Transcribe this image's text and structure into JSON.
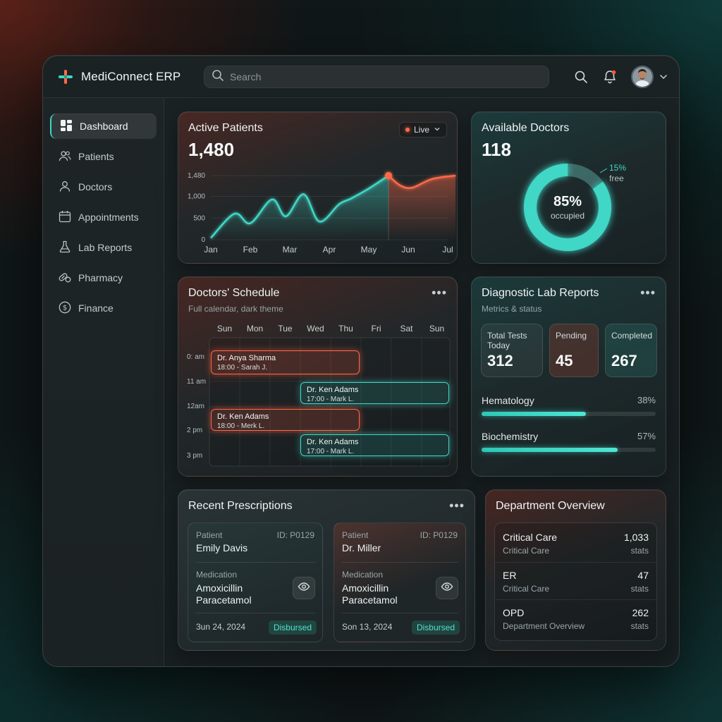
{
  "app": {
    "name": "MediConnect ERP"
  },
  "search": {
    "placeholder": "Search"
  },
  "sidebar": {
    "items": [
      {
        "label": "Dashboard",
        "icon": "grid-icon",
        "active": true
      },
      {
        "label": "Patients",
        "icon": "users-icon"
      },
      {
        "label": "Doctors",
        "icon": "user-icon"
      },
      {
        "label": "Appointments",
        "icon": "calendar-icon"
      },
      {
        "label": "Lab Reports",
        "icon": "flask-icon"
      },
      {
        "label": "Pharmacy",
        "icon": "pill-icon"
      },
      {
        "label": "Finance",
        "icon": "dollar-icon"
      }
    ]
  },
  "active_patients": {
    "title": "Active Patients",
    "value": "1,480",
    "live_label": "Live",
    "chart_data": {
      "type": "area",
      "x": [
        "Jan",
        "Feb",
        "Mar",
        "Apr",
        "May",
        "Jun",
        "Jul"
      ],
      "yticks": [
        "1,480",
        "1,000",
        "500",
        "0"
      ],
      "ylim": [
        0,
        1480
      ],
      "series": [
        {
          "values": [
            40,
            600,
            380,
            930,
            540,
            1050,
            420,
            820,
            950,
            1180,
            1480,
            1250,
            1200,
            1400,
            1480
          ]
        }
      ],
      "xpos": [
        0,
        0.6,
        1.0,
        1.55,
        1.9,
        2.35,
        2.75,
        3.25,
        3.55,
        4.0,
        4.5,
        4.8,
        5.1,
        5.6,
        6.2
      ],
      "highlight_index": 10,
      "colors": {
        "left": "#3fd7c7",
        "right": "#ff6a4a"
      }
    }
  },
  "available_doctors": {
    "title": "Available Doctors",
    "value": "118",
    "occupied_pct": "85%",
    "occupied_label": "occupied",
    "free_pct": "15%",
    "free_label": "free",
    "chart_data": {
      "type": "pie",
      "values": [
        85,
        15
      ],
      "labels": [
        "occupied",
        "free"
      ]
    }
  },
  "schedule": {
    "title": "Doctors' Schedule",
    "subtitle": "Full calendar, dark theme",
    "days": [
      "Sun",
      "Mon",
      "Tue",
      "Wed",
      "Thu",
      "Fri",
      "Sat",
      "Sun"
    ],
    "times": [
      "0: am",
      "11 am",
      "12am",
      "2 pm",
      "3 pm"
    ],
    "events": [
      {
        "name": "Dr. Anya Sharma",
        "time": "18:00 - Sarah J.",
        "color": "red"
      },
      {
        "name": "Dr. Ken Adams",
        "time": "17:00 - Mark L.",
        "color": "teal"
      },
      {
        "name": "Dr. Ken Adams",
        "time": "18:00 - Merk L.",
        "color": "red"
      },
      {
        "name": "Dr. Ken Adams",
        "time": "17:00 - Mark L.",
        "color": "teal"
      }
    ]
  },
  "lab_reports": {
    "title": "Diagnostic Lab Reports",
    "subtitle": "Metrics & status",
    "metrics": [
      {
        "label": "Total Tests Today",
        "value": "312"
      },
      {
        "label": "Pending",
        "value": "45"
      },
      {
        "label": "Completed",
        "value": "267"
      }
    ],
    "bars": [
      {
        "label": "Hematology",
        "pct": "38%",
        "fill": 0.6
      },
      {
        "label": "Biochemistry",
        "pct": "57%",
        "fill": 0.78
      }
    ]
  },
  "prescriptions": {
    "title": "Recent Prescriptions",
    "cards": [
      {
        "patient_label": "Patient",
        "id": "ID: P0129",
        "patient": "Emily Davis",
        "med_label": "Medication",
        "med1": "Amoxicillin",
        "med2": "Paracetamol",
        "date": "3un 24, 2024",
        "status": "Disbursed"
      },
      {
        "patient_label": "Patient",
        "id": "ID: P0129",
        "patient": "Dr. Miller",
        "med_label": "Medication",
        "med1": "Amoxicillin",
        "med2": "Paracetamol",
        "date": "Son 13, 2024",
        "status": "Disbursed"
      }
    ]
  },
  "departments": {
    "title": "Department Overview",
    "rows": [
      {
        "name": "Critical Care",
        "sub": "Critical Care",
        "value": "1,033",
        "stats": "stats"
      },
      {
        "name": "ER",
        "sub": "Critical Care",
        "value": "47",
        "stats": "stats"
      },
      {
        "name": "OPD",
        "sub": "Department Overview",
        "value": "262",
        "stats": "stats"
      }
    ]
  },
  "colors": {
    "accent_teal": "#3fd7c7",
    "accent_red": "#ff6a4a"
  }
}
